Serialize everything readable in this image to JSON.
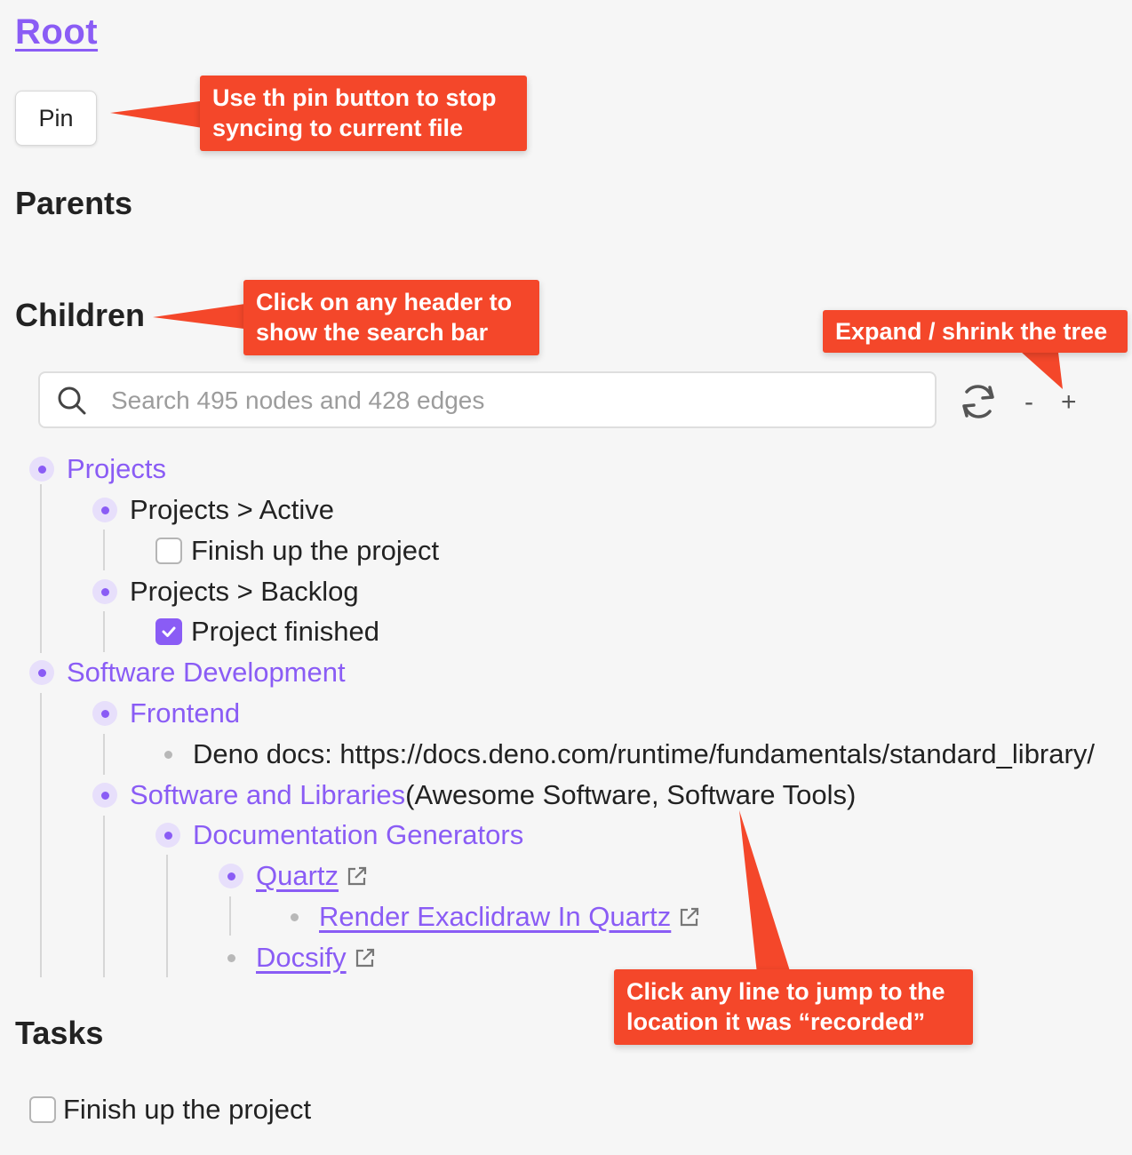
{
  "root": {
    "title": "Root"
  },
  "pin": {
    "label": "Pin"
  },
  "sections": {
    "parents": "Parents",
    "children": "Children",
    "tasks": "Tasks"
  },
  "callouts": {
    "pin": [
      "Use th pin button to stop",
      "syncing to current file"
    ],
    "header": [
      "Click on any header to",
      "show the search bar"
    ],
    "expand": [
      "Expand / shrink the tree"
    ],
    "jump": [
      "Click any line to jump to the",
      "location it was “recorded”"
    ]
  },
  "search": {
    "placeholder": "Search 495 nodes and 428 edges",
    "value": ""
  },
  "controls": {
    "refresh_icon": "refresh-icon",
    "shrink": "-",
    "expand": "+"
  },
  "tree": [
    {
      "text": "Projects"
    },
    {
      "text": "Projects > Active"
    },
    {
      "text": "Finish up the project",
      "checked": false
    },
    {
      "text": "Projects > Backlog"
    },
    {
      "text": "Project finished",
      "checked": true
    },
    {
      "text": "Software Development"
    },
    {
      "text": "Frontend"
    },
    {
      "text": "Deno docs: https://docs.deno.com/runtime/fundamentals/standard_library/"
    },
    {
      "text": "Software and Libraries",
      "aliases": "(Awesome Software, Software Tools)"
    },
    {
      "text": "Documentation Generators"
    },
    {
      "text": "Quartz",
      "icon": "external-link-icon"
    },
    {
      "text": "Render Exaclidraw In Quartz",
      "icon": "external-link-icon"
    },
    {
      "text": "Docsify",
      "icon": "external-link-icon"
    }
  ],
  "tasks": [
    {
      "text": "Finish up the project",
      "checked": false
    }
  ],
  "colors": {
    "accent": "#8a5cf5",
    "callout": "#f4472a",
    "background": "#f6f6f6"
  }
}
